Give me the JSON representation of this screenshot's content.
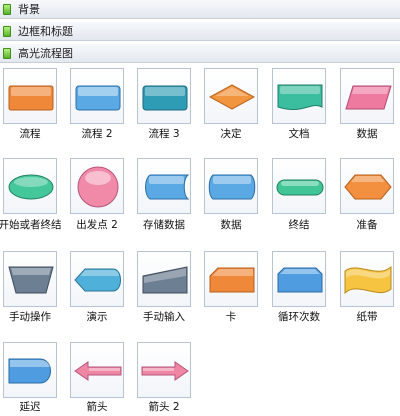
{
  "sections": [
    {
      "label": "背景"
    },
    {
      "label": "边框和标题"
    },
    {
      "label": "高光流程图"
    }
  ],
  "shapes": [
    {
      "label": "流程",
      "icon": "process-shape-icon",
      "color": "#f0883a"
    },
    {
      "label": "流程 2",
      "icon": "process-2-shape-icon",
      "color": "#5aa9e4"
    },
    {
      "label": "流程 3",
      "icon": "process-3-shape-icon",
      "color": "#2f9cb5"
    },
    {
      "label": "决定",
      "icon": "decision-shape-icon",
      "color": "#f2953f"
    },
    {
      "label": "文档",
      "icon": "document-shape-icon",
      "color": "#3bbda0"
    },
    {
      "label": "数据",
      "icon": "data-shape-icon",
      "color": "#ee7aa0"
    },
    {
      "label": "开始或者终结",
      "icon": "start-end-shape-icon",
      "color": "#44c79b"
    },
    {
      "label": "出发点 2",
      "icon": "origin-2-shape-icon",
      "color": "#f08aa8"
    },
    {
      "label": "存储数据",
      "icon": "stored-data-shape-icon",
      "color": "#5aa9e4"
    },
    {
      "label": "数据",
      "icon": "data-2-shape-icon",
      "color": "#5aa9e4"
    },
    {
      "label": "终结",
      "icon": "terminator-shape-icon",
      "color": "#40c596"
    },
    {
      "label": "准备",
      "icon": "preparation-shape-icon",
      "color": "#f29040"
    },
    {
      "label": "手动操作",
      "icon": "manual-operation-shape-icon",
      "color": "#6d7f93"
    },
    {
      "label": "演示",
      "icon": "display-shape-icon",
      "color": "#4fb0d9"
    },
    {
      "label": "手动输入",
      "icon": "manual-input-shape-icon",
      "color": "#6d7f93"
    },
    {
      "label": "卡",
      "icon": "card-shape-icon",
      "color": "#f0883a"
    },
    {
      "label": "循环次数",
      "icon": "loop-limit-shape-icon",
      "color": "#4f9de0"
    },
    {
      "label": "纸带",
      "icon": "paper-tape-shape-icon",
      "color": "#f6c440"
    },
    {
      "label": "延迟",
      "icon": "delay-shape-icon",
      "color": "#4f9de0"
    },
    {
      "label": "箭头",
      "icon": "arrow-left-shape-icon",
      "color": "#ef86a4"
    },
    {
      "label": "箭头 2",
      "icon": "arrow-right-shape-icon",
      "color": "#ef86a4"
    }
  ]
}
